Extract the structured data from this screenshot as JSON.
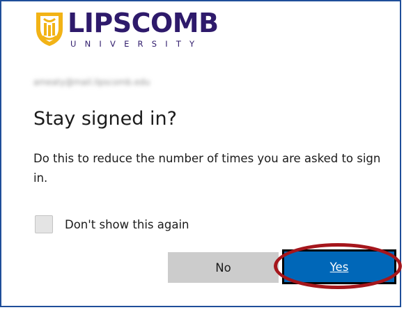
{
  "brand": {
    "name": "LIPSCOMB",
    "subtitle": "UNIVERSITY",
    "colors": {
      "purple": "#2e1a6b",
      "gold": "#f2b316"
    },
    "icon": "shield-icon"
  },
  "account": {
    "email": "ameaty@mail.lipscomb.edu"
  },
  "dialog": {
    "title": "Stay signed in?",
    "description": "Do this to reduce the number of times you are asked to sign in.",
    "checkbox_label": "Don't show this again",
    "checkbox_checked": false
  },
  "buttons": {
    "no_label": "No",
    "yes_label": "Yes"
  },
  "colors": {
    "primary": "#0067b8",
    "secondary": "#cccccc",
    "annotation": "#a5161c",
    "frame": "#1f4e99"
  }
}
